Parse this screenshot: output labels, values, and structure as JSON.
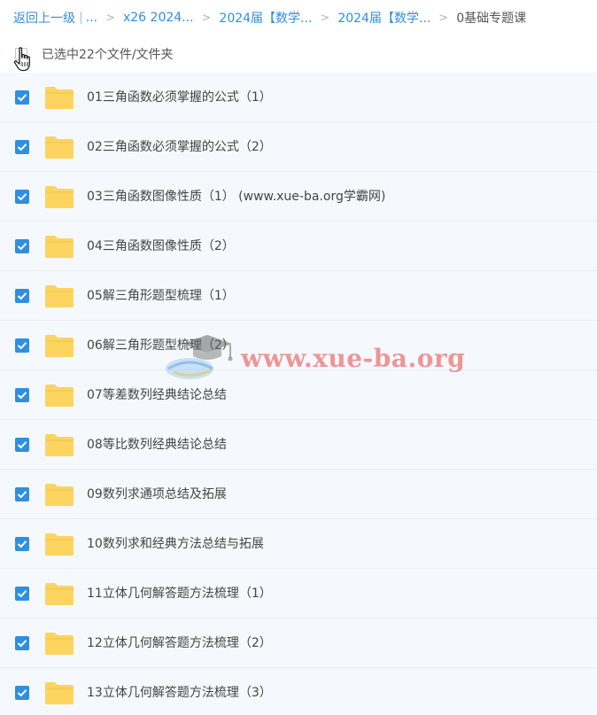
{
  "breadcrumb": {
    "back": "返回上一级",
    "ellipsis": "...",
    "items": [
      "x26 2024...",
      "2024届【数学...",
      "2024届【数学..."
    ],
    "current": "0基础专题课"
  },
  "selection": {
    "label": "已选中22个文件/文件夹"
  },
  "files": [
    "01三角函数必须掌握的公式（1）",
    "02三角函数必须掌握的公式（2）",
    "03三角函数图像性质（1）  (www.xue-ba.org学霸网)",
    "04三角函数图像性质（2）",
    "05解三角形题型梳理（1）",
    "06解三角形题型梳理（2）",
    "07等差数列经典结论总结",
    "08等比数列经典结论总结",
    "09数列求通项总结及拓展",
    "10数列求和经典方法总结与拓展",
    "11立体几何解答题方法梳理（1）",
    "12立体几何解答题方法梳理（2）",
    "13立体几何解答题方法梳理（3）"
  ],
  "watermark": {
    "text": "www.xue-ba.org"
  },
  "colors": {
    "link": "#2f8fe0",
    "checkbox": "#2f8fe0",
    "folder": "#fcd45f",
    "row_bg": "#f5f9fd"
  },
  "icons": {
    "checkbox": "check-icon",
    "folder": "folder-icon",
    "cursor": "hand-pointer-icon"
  }
}
